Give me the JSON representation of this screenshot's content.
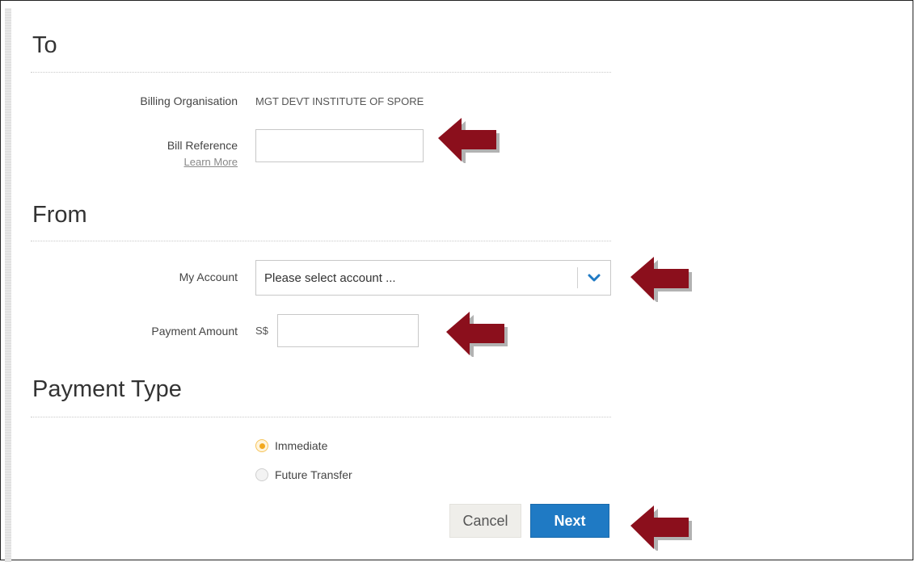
{
  "to": {
    "title": "To",
    "billing_org_label": "Billing Organisation",
    "billing_org_value": "MGT DEVT INSTITUTE OF SPORE",
    "bill_reference_label": "Bill Reference",
    "bill_reference_value": "",
    "learn_more": "Learn More"
  },
  "from": {
    "title": "From",
    "my_account_label": "My Account",
    "my_account_selected": "Please select account ...",
    "payment_amount_label": "Payment Amount",
    "currency": "S$",
    "payment_amount_value": ""
  },
  "payment_type": {
    "title": "Payment Type",
    "options": [
      {
        "label": "Immediate",
        "checked": true
      },
      {
        "label": "Future Transfer",
        "checked": false
      }
    ]
  },
  "buttons": {
    "cancel": "Cancel",
    "next": "Next"
  },
  "colors": {
    "accent": "#1f7ac4",
    "arrow": "#8b0f1c",
    "radio_selected": "#f2a81d"
  },
  "icons": {
    "dropdown": "chevron-down-icon",
    "annotation": "arrow-left-icon"
  }
}
